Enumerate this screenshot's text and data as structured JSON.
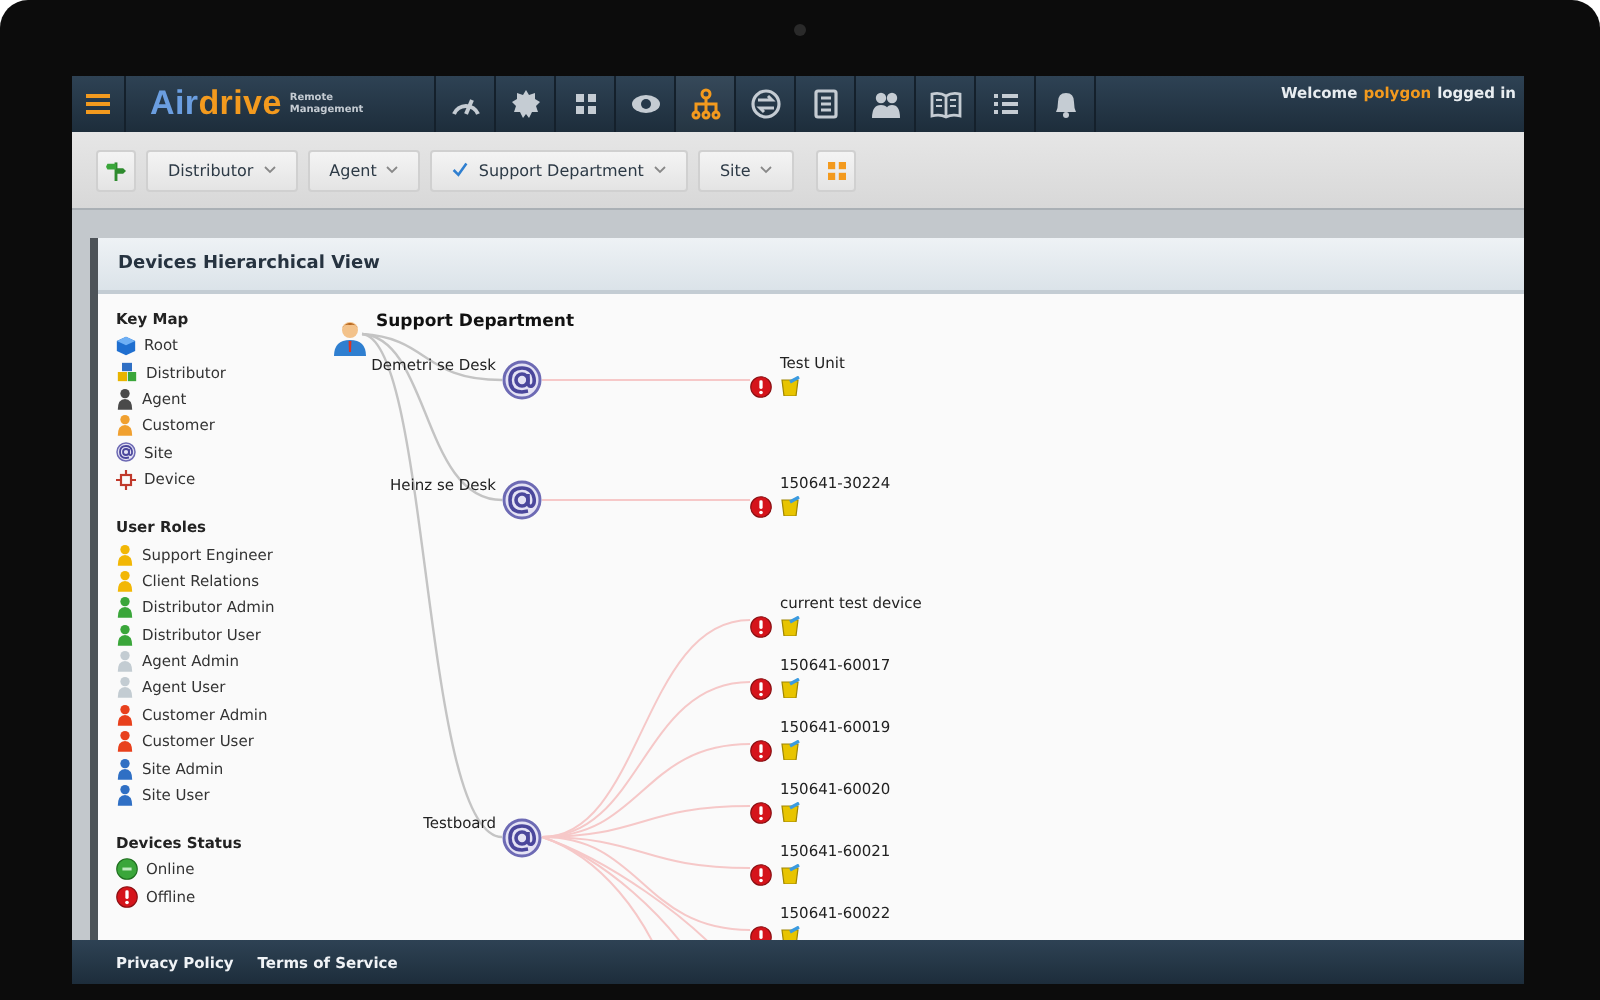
{
  "nav": {
    "logo": {
      "name_start": "Air",
      "name_end": "drive",
      "tagline": "Remote Management"
    },
    "items": [
      {
        "kind": "gauge",
        "selected": false
      },
      {
        "kind": "gear",
        "selected": false
      },
      {
        "kind": "grid",
        "selected": false
      },
      {
        "kind": "eye",
        "selected": false
      },
      {
        "kind": "hierarchy",
        "selected": true
      },
      {
        "kind": "sync",
        "selected": false
      },
      {
        "kind": "document",
        "selected": false
      },
      {
        "kind": "users",
        "selected": false
      },
      {
        "kind": "book",
        "selected": false
      },
      {
        "kind": "list",
        "selected": false
      },
      {
        "kind": "bell",
        "selected": false
      }
    ],
    "welcome": {
      "prefix": "Welcome",
      "user": "polygon",
      "suffix": "logged in"
    }
  },
  "toolbar": {
    "buttons": [
      {
        "kind": "signpost"
      },
      {
        "kind": "filter",
        "label": "Distributor",
        "checked": false
      },
      {
        "kind": "filter",
        "label": "Agent",
        "checked": false
      },
      {
        "kind": "filter",
        "label": "Support Department",
        "checked": true
      },
      {
        "kind": "filter",
        "label": "Site",
        "checked": false
      },
      {
        "kind": "grid"
      }
    ]
  },
  "panel": {
    "title": "Devices Hierarchical View",
    "key_map": {
      "title": "Key Map",
      "items": [
        {
          "kind": "root",
          "label": "Root"
        },
        {
          "kind": "distributor",
          "label": "Distributor"
        },
        {
          "kind": "agent",
          "label": "Agent"
        },
        {
          "kind": "customer",
          "label": "Customer"
        },
        {
          "kind": "site",
          "label": "Site"
        },
        {
          "kind": "device",
          "label": "Device"
        }
      ]
    },
    "user_roles": {
      "title": "User Roles",
      "items": [
        {
          "label": "Support Engineer",
          "color": "#f2b705"
        },
        {
          "label": "Client Relations",
          "color": "#f2b705"
        },
        {
          "label": "Distributor Admin",
          "color": "#3aa63a"
        },
        {
          "label": "Distributor User",
          "color": "#3aa63a"
        },
        {
          "label": "Agent Admin",
          "color": "#c3ccd2"
        },
        {
          "label": "Agent User",
          "color": "#c3ccd2"
        },
        {
          "label": "Customer Admin",
          "color": "#e8401c"
        },
        {
          "label": "Customer User",
          "color": "#e8401c"
        },
        {
          "label": "Site Admin",
          "color": "#2f6fc4"
        },
        {
          "label": "Site User",
          "color": "#2f6fc4"
        }
      ]
    },
    "device_status": {
      "title": "Devices Status",
      "items": [
        {
          "kind": "online",
          "label": "Online"
        },
        {
          "kind": "offline",
          "label": "Offline"
        }
      ]
    },
    "hierarchy": {
      "label": "Support Department",
      "children": [
        {
          "label": "Demetri se Desk",
          "children": [
            {
              "label": "Test Unit",
              "offline": true
            }
          ]
        },
        {
          "label": "Heinz se Desk",
          "children": [
            {
              "label": "150641-30224",
              "offline": true
            }
          ]
        },
        {
          "label": "Testboard",
          "children": [
            {
              "label": "current test device",
              "offline": true
            },
            {
              "label": "150641-60017",
              "offline": true
            },
            {
              "label": "150641-60019",
              "offline": true
            },
            {
              "label": "150641-60020",
              "offline": true
            },
            {
              "label": "150641-60021",
              "offline": true
            },
            {
              "label": "150641-60022",
              "offline": true
            }
          ]
        }
      ]
    }
  },
  "footer": {
    "links": [
      "Privacy Policy",
      "Terms of Service"
    ]
  }
}
